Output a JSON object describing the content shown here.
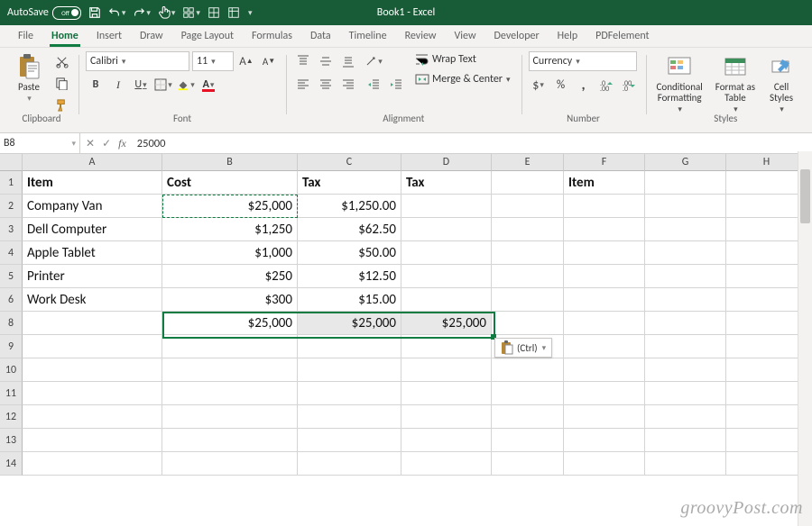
{
  "app": {
    "title": "Book1 - Excel"
  },
  "quick_access": {
    "autosave_label": "AutoSave",
    "autosave_state": "Off"
  },
  "tabs": {
    "file": "File",
    "home": "Home",
    "insert": "Insert",
    "draw": "Draw",
    "page_layout": "Page Layout",
    "formulas": "Formulas",
    "data": "Data",
    "timeline": "Timeline",
    "review": "Review",
    "view": "View",
    "developer": "Developer",
    "help": "Help",
    "pdfelement": "PDFelement"
  },
  "ribbon": {
    "clipboard": {
      "paste": "Paste",
      "group": "Clipboard"
    },
    "font": {
      "name": "Calibri",
      "size": "11",
      "group": "Font"
    },
    "alignment": {
      "wrap": "Wrap Text",
      "merge": "Merge & Center",
      "group": "Alignment"
    },
    "number": {
      "format": "Currency",
      "group": "Number"
    },
    "styles": {
      "cond": "Conditional\nFormatting",
      "table": "Format as\nTable",
      "cell": "Cell\nStyles",
      "group": "Styles"
    }
  },
  "namebox": "B8",
  "formula_bar": "25000",
  "columns": [
    "A",
    "B",
    "C",
    "D",
    "E",
    "F",
    "G",
    "H"
  ],
  "row_numbers": [
    "1",
    "2",
    "3",
    "4",
    "5",
    "6",
    "8",
    "9",
    "10",
    "11",
    "12",
    "13",
    "14"
  ],
  "grid": {
    "headers": {
      "A1": "Item",
      "B1": "Cost",
      "C1": "Tax",
      "D1": "Tax",
      "F1": "Item"
    },
    "rows": [
      {
        "A": "Company Van",
        "B": "$25,000",
        "C": "$1,250.00"
      },
      {
        "A": "Dell Computer",
        "B": "$1,250",
        "C": "$62.50"
      },
      {
        "A": "Apple Tablet",
        "B": "$1,000",
        "C": "$50.00"
      },
      {
        "A": "Printer",
        "B": "$250",
        "C": "$12.50"
      },
      {
        "A": "Work Desk",
        "B": "$300",
        "C": "$15.00"
      }
    ],
    "row8": {
      "B": "$25,000",
      "C": "$25,000",
      "D": "$25,000"
    }
  },
  "paste_options": {
    "label": "(Ctrl)"
  },
  "watermark": "groovyPost.com"
}
